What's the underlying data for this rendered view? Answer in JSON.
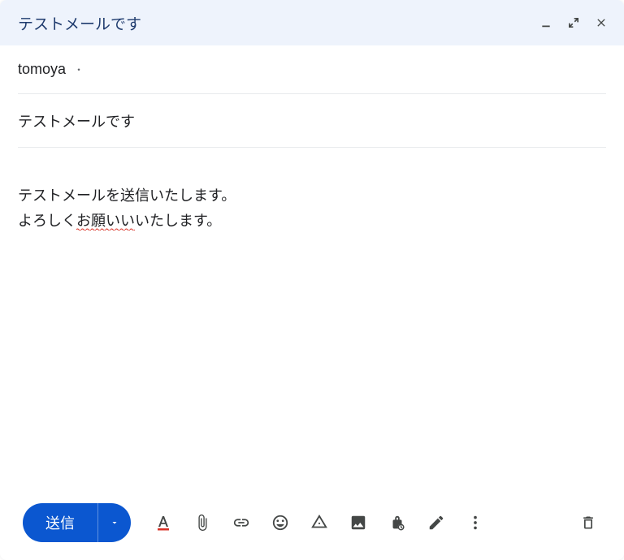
{
  "header": {
    "title": "テストメールです"
  },
  "recipients": {
    "to": "tomoya",
    "separator": "・"
  },
  "subject": "テストメールです",
  "body": {
    "line1": "テストメールを送信いたします。",
    "line2_pre": "よろしく",
    "line2_wave": "お願いい",
    "line2_post": "いたします。"
  },
  "footer": {
    "send_label": "送信"
  }
}
